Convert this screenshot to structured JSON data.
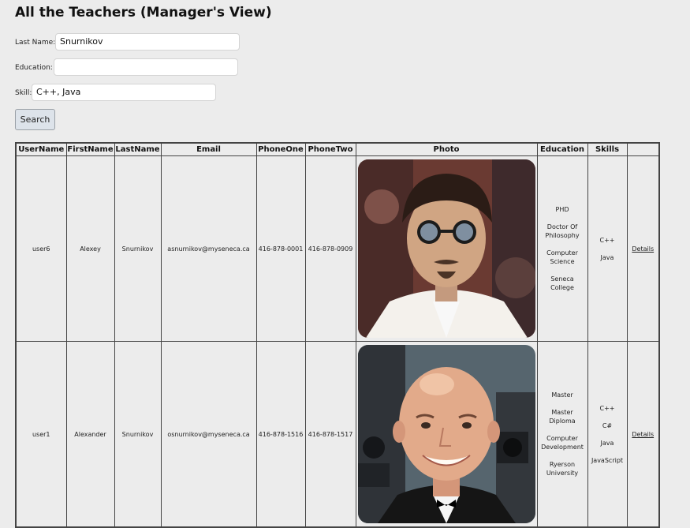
{
  "page": {
    "title": "All the Teachers (Manager's View)"
  },
  "search_form": {
    "last_name_label": "Last Name:",
    "last_name_value": "Snurnikov",
    "education_label": "Education:",
    "education_value": "",
    "skill_label": "Skill:",
    "skill_value": "C++, Java",
    "search_button": "Search"
  },
  "table": {
    "headers": [
      "UserName",
      "FirstName",
      "LastName",
      "Email",
      "PhoneOne",
      "PhoneTwo",
      "Photo",
      "Education",
      "Skills",
      ""
    ],
    "rows": [
      {
        "username": "user6",
        "firstname": "Alexey",
        "lastname": "Snurnikov",
        "email": "asnurnikov@myseneca.ca",
        "phone_one": "416-878-0001",
        "phone_two": "416-878-0909",
        "photo_description": "portrait-photo",
        "education": [
          "PHD",
          "Doctor Of Philosophy",
          "Computer Science",
          "Seneca College"
        ],
        "skills": [
          "C++",
          "Java"
        ],
        "details_link": "Details"
      },
      {
        "username": "user1",
        "firstname": "Alexander",
        "lastname": "Snurnikov",
        "email": "osnurnikov@myseneca.ca",
        "phone_one": "416-878-1516",
        "phone_two": "416-878-1517",
        "photo_description": "portrait-photo",
        "education": [
          "Master",
          "Master Diploma",
          "Computer Development",
          "Ryerson University"
        ],
        "skills": [
          "C++",
          "C#",
          "Java",
          "JavaScript"
        ],
        "details_link": "Details"
      }
    ]
  }
}
